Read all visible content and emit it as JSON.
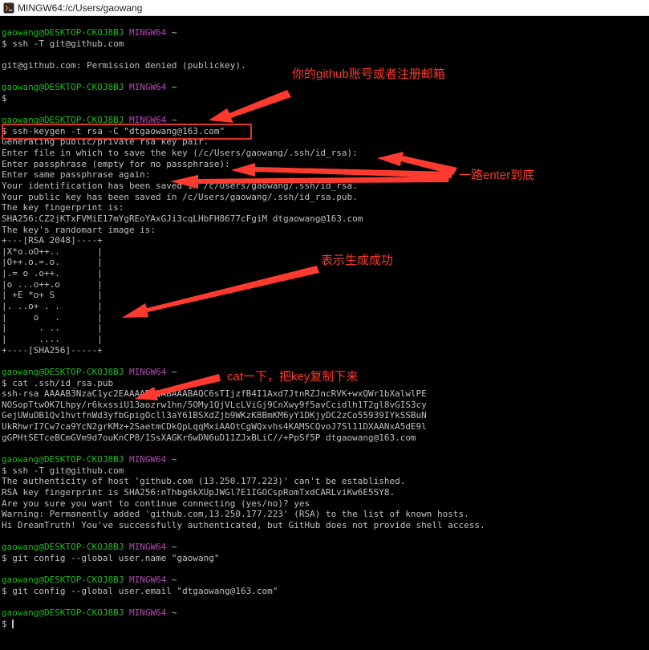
{
  "window": {
    "title": "MINGW64:/c/Users/gaowang"
  },
  "prompt": {
    "user_host": "gaowang@DESKTOP-CKOJ8BJ",
    "shell": "MINGW64",
    "dir": "~",
    "symbol": "$"
  },
  "lines": [
    {
      "kind": "prompt"
    },
    {
      "kind": "cmd",
      "text": "$ ssh -T git@github.com"
    },
    {
      "kind": "blank"
    },
    {
      "kind": "out",
      "text": "git@github.com: Permission denied (publickey)."
    },
    {
      "kind": "blank"
    },
    {
      "kind": "prompt"
    },
    {
      "kind": "cmd",
      "text": "$"
    },
    {
      "kind": "blank"
    },
    {
      "kind": "prompt"
    },
    {
      "kind": "cmd",
      "text": "$ ssh-keygen -t rsa -C \"dtgaowang@163.com\""
    },
    {
      "kind": "out",
      "text": "Generating public/private rsa key pair."
    },
    {
      "kind": "out",
      "text": "Enter file in which to save the key (/c/Users/gaowang/.ssh/id_rsa):"
    },
    {
      "kind": "out",
      "text": "Enter passphrase (empty for no passphrase):"
    },
    {
      "kind": "out",
      "text": "Enter same passphrase again:"
    },
    {
      "kind": "out",
      "text": "Your identification has been saved in /c/Users/gaowang/.ssh/id_rsa."
    },
    {
      "kind": "out",
      "text": "Your public key has been saved in /c/Users/gaowang/.ssh/id_rsa.pub."
    },
    {
      "kind": "out",
      "text": "The key fingerprint is:"
    },
    {
      "kind": "out",
      "text": "SHA256:CZ2jKTxFVMiE17mYgREoYAxGJi3cqLHbFH8677cFgiM dtgaowang@163.com"
    },
    {
      "kind": "out",
      "text": "The key's randomart image is:"
    },
    {
      "kind": "out",
      "text": "+---[RSA 2048]----+"
    },
    {
      "kind": "out",
      "text": "|X*o.oO++..       |"
    },
    {
      "kind": "out",
      "text": "|O++.o.=.o.       |"
    },
    {
      "kind": "out",
      "text": "|.= o .o++.       |"
    },
    {
      "kind": "out",
      "text": "|o ...o++.o       |"
    },
    {
      "kind": "out",
      "text": "| +E *o+ S        |"
    },
    {
      "kind": "out",
      "text": "|. ..o+ . .       |"
    },
    {
      "kind": "out",
      "text": "|     o   .       |"
    },
    {
      "kind": "out",
      "text": "|      . ..       |"
    },
    {
      "kind": "out",
      "text": "|      ....       |"
    },
    {
      "kind": "out",
      "text": "+----[SHA256]-----+"
    },
    {
      "kind": "blank"
    },
    {
      "kind": "prompt"
    },
    {
      "kind": "cmd",
      "text": "$ cat .ssh/id_rsa.pub"
    },
    {
      "kind": "out",
      "text": "ssh-rsa AAAAB3NzaC1yc2EAAAADAQABAAABAQC6sTIjzfB4I1Axd7JtnRZJncRVK+wxQWr1bXalwlPE"
    },
    {
      "kind": "out",
      "text": "NOSopTtwOK7Lhpy/r6kxssiU13aozrw1hn/5OMy1QjVLcLViGj9CnXwy9f5avCcidlh1T2gl8vGIS3cy"
    },
    {
      "kind": "out",
      "text": "GejUWuOB1Qv1hvtfnWd3yfbGpigOcll3aY61BSXdZjb9WKzK8BmKM6yY1DKjyDC2zCo55939IYkSSBuN"
    },
    {
      "kind": "out",
      "text": "UkRhwrI7Cw7ca9YcN2grKMz+2SaetmCDkQpLqqMxiAAOtCgWQxvhs4KAMSCQvoJ7Sl11DXAANxA5dE9l"
    },
    {
      "kind": "out",
      "text": "gGPHtSETceBCmGVm9d7ouKnCP8/1SsXAGKr6wDN6uD11ZJxBLiC//+PpSf5P dtgaowang@163.com"
    },
    {
      "kind": "blank"
    },
    {
      "kind": "prompt"
    },
    {
      "kind": "cmd",
      "text": "$ ssh -T git@github.com"
    },
    {
      "kind": "out",
      "text": "The authenticity of host 'github.com (13.250.177.223)' can't be established."
    },
    {
      "kind": "out",
      "text": "RSA key fingerprint is SHA256:nThbg6kXUpJWGl7E1IGOCspRomTxdCARLviKw6E5SY8."
    },
    {
      "kind": "out",
      "text": "Are you sure you want to continue connecting (yes/no)? yes"
    },
    {
      "kind": "out",
      "text": "Warning: Permanently added 'github.com,13.250.177.223' (RSA) to the list of known hosts."
    },
    {
      "kind": "out",
      "text": "Hi DreamTruth! You've successfully authenticated, but GitHub does not provide shell access."
    },
    {
      "kind": "blank"
    },
    {
      "kind": "prompt"
    },
    {
      "kind": "cmd",
      "text": "$ git config --global user.name \"gaowang\""
    },
    {
      "kind": "blank"
    },
    {
      "kind": "prompt"
    },
    {
      "kind": "cmd",
      "text": "$ git config --global user.email \"dtgaowang@163.com\""
    },
    {
      "kind": "blank"
    },
    {
      "kind": "prompt"
    },
    {
      "kind": "cursor",
      "text": "$ "
    }
  ],
  "annotations": {
    "email_note": "你的github账号或者注册邮箱",
    "enter_note": "一路enter到底",
    "success_note": "表示生成成功",
    "cat_note": "cat一下，把key复制下来"
  },
  "colors": {
    "annotation": "#ff3a2e",
    "user_host": "#1bbf1b",
    "shell_name": "#b548b5",
    "text": "#c0c0c0",
    "background": "#000000"
  }
}
